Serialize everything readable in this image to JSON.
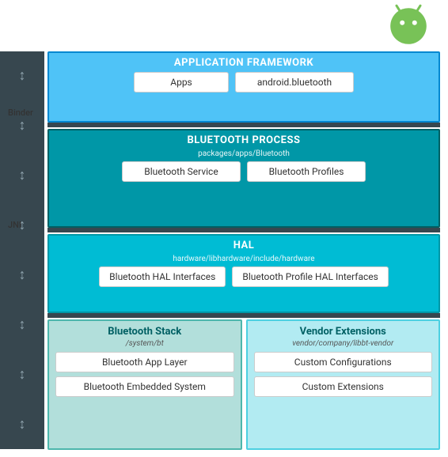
{
  "android_icon": {
    "color": "#78c257",
    "label": "Android Robot"
  },
  "sections": {
    "app_framework": {
      "title": "APPLICATION FRAMEWORK",
      "boxes": [
        {
          "label": "Apps"
        },
        {
          "label": "android.bluetooth"
        }
      ]
    },
    "bt_process": {
      "title": "BLUETOOTH PROCESS",
      "subtitle": "packages/apps/Bluetooth",
      "boxes": [
        {
          "label": "Bluetooth Service"
        },
        {
          "label": "Bluetooth Profiles"
        }
      ]
    },
    "hal": {
      "title": "HAL",
      "subtitle": "hardware/libhardware/include/hardware",
      "boxes": [
        {
          "label": "Bluetooth HAL Interfaces"
        },
        {
          "label": "Bluetooth Profile HAL Interfaces"
        }
      ]
    },
    "bt_stack": {
      "title": "Bluetooth Stack",
      "subtitle": "/system/bt",
      "boxes": [
        {
          "label": "Bluetooth App Layer"
        },
        {
          "label": "Bluetooth Embedded System"
        }
      ]
    },
    "vendor_ext": {
      "title": "Vendor Extensions",
      "subtitle": "vendor/company/libbt-vendor",
      "boxes": [
        {
          "label": "Custom Configurations"
        },
        {
          "label": "Custom Extensions"
        }
      ]
    }
  },
  "labels": {
    "binder": "Binder",
    "jni": "JNI"
  }
}
